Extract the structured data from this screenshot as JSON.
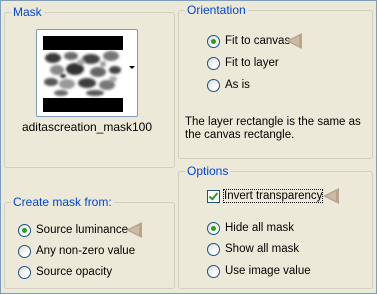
{
  "mask_group": {
    "title": "Mask",
    "mask_name": "aditascreation_mask100"
  },
  "create_mask_group": {
    "title": "Create mask from:",
    "options": [
      {
        "label": "Source luminance",
        "checked": true
      },
      {
        "label": "Any non-zero value",
        "checked": false
      },
      {
        "label": "Source opacity",
        "checked": false
      }
    ]
  },
  "orientation_group": {
    "title": "Orientation",
    "options": [
      {
        "label": "Fit to canvas",
        "checked": true
      },
      {
        "label": "Fit to layer",
        "checked": false
      },
      {
        "label": "As is",
        "checked": false
      }
    ],
    "description": "The layer rectangle is the same as the canvas rectangle."
  },
  "options_group": {
    "title": "Options",
    "invert_label": "Invert transparency",
    "invert_checked": true,
    "mask_options": [
      {
        "label": "Hide all mask",
        "checked": true
      },
      {
        "label": "Show all mask",
        "checked": false
      },
      {
        "label": "Use image value",
        "checked": false
      }
    ]
  },
  "colors": {
    "background": "#ECE9D8",
    "group_title": "#0046D5",
    "pointer_arrow": "#B7A58C"
  },
  "icons": {
    "pointer": "left-pointing-arrow-icon",
    "dropdown": "chevron-down-icon"
  }
}
